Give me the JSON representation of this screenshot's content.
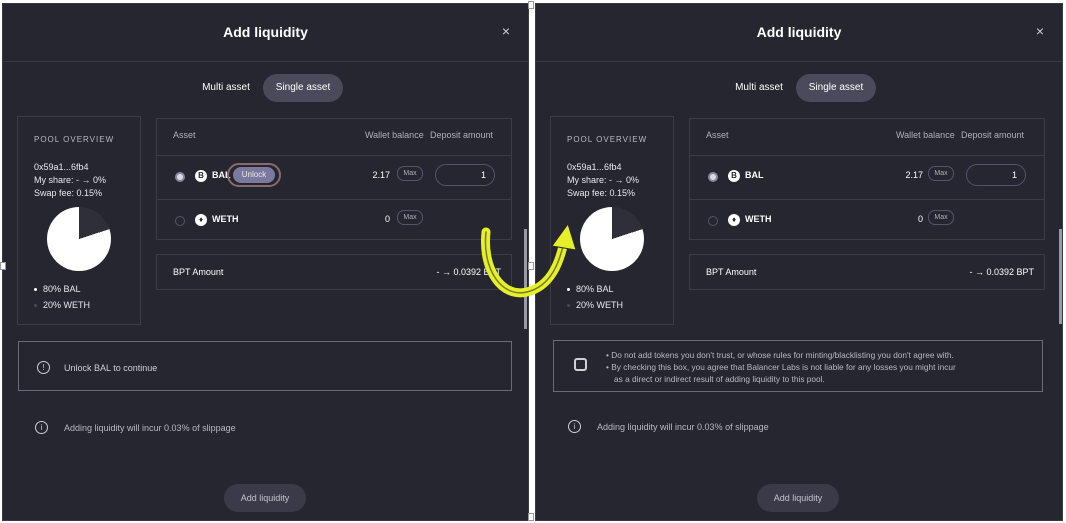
{
  "left": {
    "title": "Add liquidity",
    "close": "×",
    "tabs": {
      "multi": "Multi asset",
      "single": "Single asset"
    },
    "overview": {
      "title": "POOL OVERVIEW",
      "address": "0x59a1...6fb4",
      "my_share": "My share: - → 0%",
      "swap_fee": "Swap fee: 0.15%",
      "legend": [
        "80% BAL",
        "20% WETH"
      ]
    },
    "table": {
      "headers": {
        "asset": "Asset",
        "wallet": "Wallet balance",
        "deposit": "Deposit amount"
      },
      "rows": [
        {
          "token": "BAL",
          "balance": "2.17",
          "max": "Max",
          "amount": "1",
          "unlock": "Unlock"
        },
        {
          "token": "WETH",
          "balance": "0",
          "max": "Max"
        }
      ]
    },
    "bpt": {
      "label": "BPT Amount",
      "value": "- → 0.0392 BPT"
    },
    "notice": "Unlock BAL to continue",
    "slippage": "Adding liquidity will incur 0.03% of slippage",
    "add_button": "Add liquidity"
  },
  "right": {
    "title": "Add liquidity",
    "close": "×",
    "tabs": {
      "multi": "Multi asset",
      "single": "Single asset"
    },
    "overview": {
      "title": "POOL OVERVIEW",
      "address": "0x59a1...6fb4",
      "my_share": "My share: - → 0%",
      "swap_fee": "Swap fee: 0.15%",
      "legend": [
        "80% BAL",
        "20% WETH"
      ]
    },
    "table": {
      "headers": {
        "asset": "Asset",
        "wallet": "Wallet balance",
        "deposit": "Deposit amount"
      },
      "rows": [
        {
          "token": "BAL",
          "balance": "2.17",
          "max": "Max",
          "amount": "1"
        },
        {
          "token": "WETH",
          "balance": "0",
          "max": "Max"
        }
      ]
    },
    "bpt": {
      "label": "BPT Amount",
      "value": "- → 0.0392 BPT"
    },
    "warning": [
      "• Do not add tokens you don't trust, or whose rules for minting/blacklisting you don't agree with.",
      "• By checking this box, you agree that Balancer Labs is not liable for any losses you might incur",
      "as a direct or indirect result of adding liquidity to this pool."
    ],
    "slippage": "Adding liquidity will incur 0.03% of slippage",
    "add_button": "Add liquidity"
  },
  "colors": {
    "panel_bg": "#262630",
    "accent_arrow": "#e6f02a",
    "selected_tab": "#4a4a5a"
  }
}
